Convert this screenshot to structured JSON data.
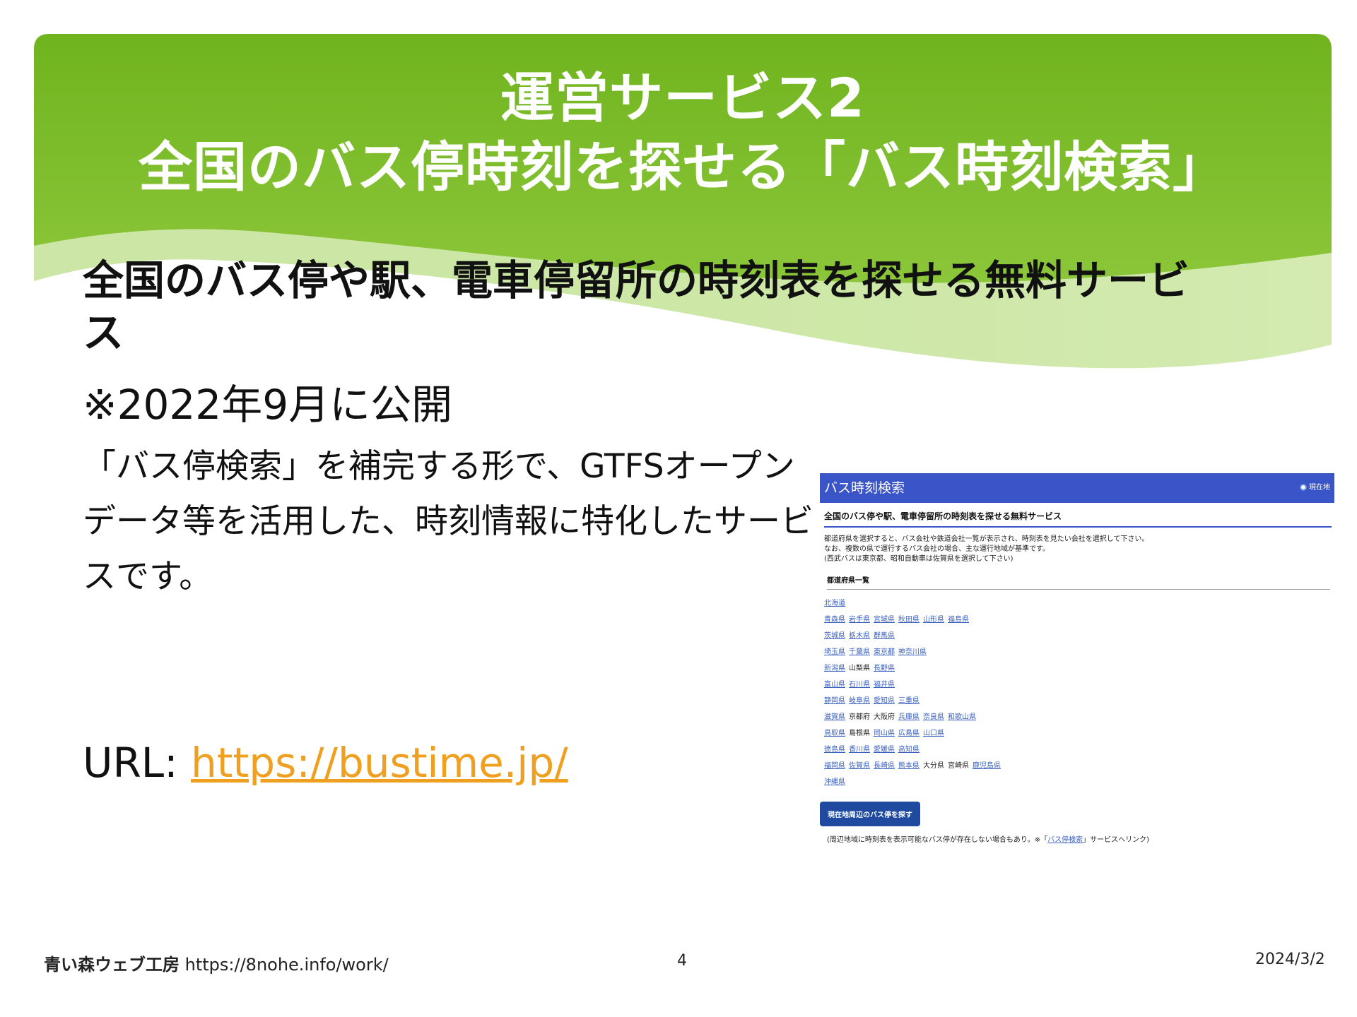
{
  "slide": {
    "title_line1": "運営サービス2",
    "title_line2": "全国のバス停時刻を探せる「バス時刻検索」",
    "lead": "全国のバス停や駅、電車停留所の時刻表を探せる無料サービス",
    "note": "※2022年9月に公開",
    "description": "「バス停検索」を補完する形で、GTFSオープンデータ等を活用した、時刻情報に特化したサービスです。",
    "url_label": "URL: ",
    "url_link": "https://bustime.jp/",
    "colors": {
      "header_green": "#7cba2a",
      "link_orange": "#f0a020"
    }
  },
  "screenshot": {
    "app_title": "バス時刻検索",
    "location_label": "現在地",
    "subtitle": "全国のバス停や駅、電車停留所の時刻表を探せる無料サービス",
    "intro_lines": [
      "都道府県を選択すると、バス会社や鉄道会社一覧が表示され、時刻表を見たい会社を選択して下さい。",
      "なお、複数の県で運行するバス会社の場合、主な運行地域が基準です。",
      "(西武バスは東京都、昭和自動車は佐賀県を選択して下さい)"
    ],
    "list_heading": "都道府県一覧",
    "prefecture_rows": [
      [
        {
          "name": "北海道",
          "link": true
        }
      ],
      [
        {
          "name": "青森県",
          "link": true
        },
        {
          "name": "岩手県",
          "link": true
        },
        {
          "name": "宮城県",
          "link": true
        },
        {
          "name": "秋田県",
          "link": true
        },
        {
          "name": "山形県",
          "link": true
        },
        {
          "name": "福島県",
          "link": true
        }
      ],
      [
        {
          "name": "茨城県",
          "link": true
        },
        {
          "name": "栃木県",
          "link": true
        },
        {
          "name": "群馬県",
          "link": true
        }
      ],
      [
        {
          "name": "埼玉県",
          "link": true
        },
        {
          "name": "千葉県",
          "link": true
        },
        {
          "name": "東京都",
          "link": true
        },
        {
          "name": "神奈川県",
          "link": true
        }
      ],
      [
        {
          "name": "新潟県",
          "link": true
        },
        {
          "name": "山梨県",
          "link": false
        },
        {
          "name": "長野県",
          "link": true
        }
      ],
      [
        {
          "name": "富山県",
          "link": true
        },
        {
          "name": "石川県",
          "link": true
        },
        {
          "name": "福井県",
          "link": true
        }
      ],
      [
        {
          "name": "静岡県",
          "link": true
        },
        {
          "name": "岐阜県",
          "link": true
        },
        {
          "name": "愛知県",
          "link": true
        },
        {
          "name": "三重県",
          "link": true
        }
      ],
      [
        {
          "name": "滋賀県",
          "link": true
        },
        {
          "name": "京都府",
          "link": false
        },
        {
          "name": "大阪府",
          "link": false
        },
        {
          "name": "兵庫県",
          "link": true
        },
        {
          "name": "奈良県",
          "link": true
        },
        {
          "name": "和歌山県",
          "link": true
        }
      ],
      [
        {
          "name": "鳥取県",
          "link": true
        },
        {
          "name": "島根県",
          "link": false
        },
        {
          "name": "岡山県",
          "link": true
        },
        {
          "name": "広島県",
          "link": true
        },
        {
          "name": "山口県",
          "link": true
        }
      ],
      [
        {
          "name": "徳島県",
          "link": true
        },
        {
          "name": "香川県",
          "link": true
        },
        {
          "name": "愛媛県",
          "link": true
        },
        {
          "name": "高知県",
          "link": true
        }
      ],
      [
        {
          "name": "福岡県",
          "link": true
        },
        {
          "name": "佐賀県",
          "link": true
        },
        {
          "name": "長崎県",
          "link": true
        },
        {
          "name": "熊本県",
          "link": true
        },
        {
          "name": "大分県",
          "link": false
        },
        {
          "name": "宮崎県",
          "link": false
        },
        {
          "name": "鹿児島県",
          "link": true
        }
      ],
      [
        {
          "name": "沖縄県",
          "link": true
        }
      ]
    ],
    "nearby_button": "現在地周辺のバス停を探す",
    "footnote_pre": "(周辺地域に時刻表を表示可能なバス停が存在しない場合もあり。※「",
    "footnote_link": "バス停検索",
    "footnote_post": "」サービスへリンク)"
  },
  "footer": {
    "brand": "青い森ウェブ工房",
    "brand_url": "https://8nohe.info/work/",
    "page_number": "4",
    "date": "2024/3/2"
  }
}
